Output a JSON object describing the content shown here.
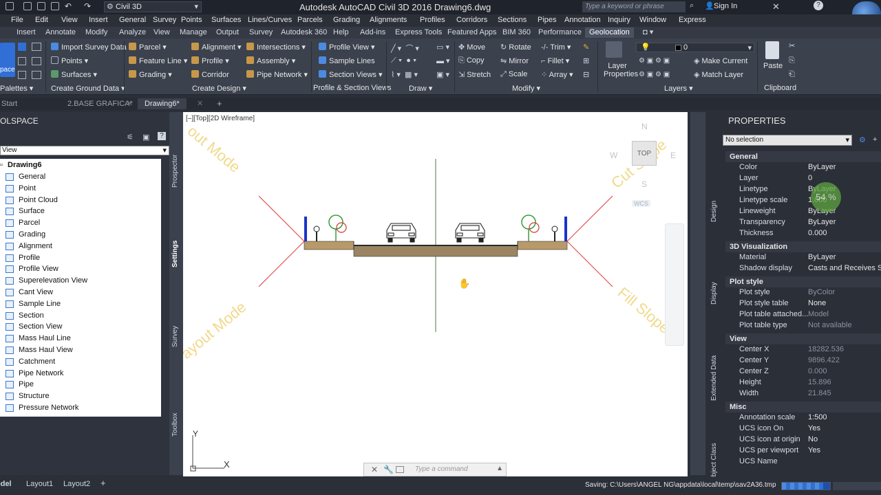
{
  "app": {
    "title": "Autodesk AutoCAD Civil 3D 2016    Drawing6.dwg",
    "workspace": "Civil 3D",
    "search_placeholder": "Type a keyword or phrase",
    "signin": "Sign In"
  },
  "menubar": [
    "File",
    "Edit",
    "View",
    "Insert",
    "General",
    "Survey",
    "Points",
    "Surfaces",
    "Lines/Curves",
    "Parcels",
    "Grading",
    "Alignments",
    "Profiles",
    "Corridors",
    "Sections",
    "Pipes",
    "Annotation",
    "Inquiry",
    "Window",
    "Express"
  ],
  "ribbon_tabs": [
    "Insert",
    "Annotate",
    "Modify",
    "Analyze",
    "View",
    "Manage",
    "Output",
    "Survey",
    "Autodesk 360",
    "Help",
    "Add-ins",
    "Express Tools",
    "Featured Apps",
    "BIM 360",
    "Performance",
    "Geolocation"
  ],
  "ribbon": {
    "palettes_label": "Palettes",
    "space_label": "pace",
    "ground": [
      "Import Survey Data",
      "Points",
      "Surfaces"
    ],
    "ground_title": "Create Ground Data",
    "design_col1": [
      "Parcel",
      "Feature Line",
      "Grading"
    ],
    "design_col2": [
      "Alignment",
      "Profile",
      "Corridor"
    ],
    "design_col3": [
      "Intersections",
      "Assembly",
      "Pipe Network"
    ],
    "design_title": "Create Design",
    "ps": [
      "Profile View",
      "Sample Lines",
      "Section Views"
    ],
    "ps_title": "Profile & Section Views",
    "draw_title": "Draw",
    "modify_col1": [
      "Move",
      "Copy",
      "Stretch"
    ],
    "modify_col2": [
      "Rotate",
      "Mirror",
      "Scale"
    ],
    "modify_col3": [
      "Trim",
      "Fillet",
      "Array"
    ],
    "modify_title": "Modify",
    "layer_props": [
      "Layer",
      "Properties"
    ],
    "layer_current": "0",
    "layer_btns": [
      "Make Current",
      "Match Layer"
    ],
    "layers_title": "Layers",
    "paste": "Paste",
    "clipboard_title": "Clipboard"
  },
  "doctabs": [
    "Start",
    "2.BASE GRAFICA*",
    "Drawing6*"
  ],
  "toolspace": {
    "title": "OLSPACE",
    "view": "View",
    "root": "Drawing6",
    "items": [
      "General",
      "Point",
      "Point Cloud",
      "Surface",
      "Parcel",
      "Grading",
      "Alignment",
      "Profile",
      "Profile View",
      "Superelevation View",
      "Cant View",
      "Sample Line",
      "Section",
      "Section View",
      "Mass Haul Line",
      "Mass Haul View",
      "Catchment",
      "Pipe Network",
      "Pipe",
      "Structure",
      "Pressure Network"
    ],
    "vtabs": [
      "Prospector",
      "Settings",
      "Survey",
      "Toolbox"
    ]
  },
  "canvas": {
    "viewport_label": "[–][Top][2D Wireframe]",
    "watermark_tl": "out Mode",
    "watermark_tr": "Cut Slope",
    "watermark_bl": "ayout Mode",
    "watermark_br": "Fill Slope",
    "viewcube": {
      "n": "N",
      "s": "S",
      "e": "E",
      "w": "W",
      "top": "TOP",
      "wcs": "WCS"
    },
    "ucs_x": "X",
    "ucs_y": "Y",
    "command_placeholder": "Type  a  command"
  },
  "properties": {
    "title": "PROPERTIES",
    "selection": "No selection",
    "side_tabs": [
      "Design",
      "Display",
      "Extended Data",
      "Object Class"
    ],
    "general_title": "General",
    "general": [
      {
        "label": "Color",
        "value": "ByLayer"
      },
      {
        "label": "Layer",
        "value": "0"
      },
      {
        "label": "Linetype",
        "value": "ByLayer"
      },
      {
        "label": "Linetype scale",
        "value": "1.000"
      },
      {
        "label": "Lineweight",
        "value": "ByLayer"
      },
      {
        "label": "Transparency",
        "value": "ByLayer"
      },
      {
        "label": "Thickness",
        "value": "0.000"
      }
    ],
    "viz_title": "3D Visualization",
    "viz": [
      {
        "label": "Material",
        "value": "ByLayer"
      },
      {
        "label": "Shadow display",
        "value": "Casts and Receives Sha"
      }
    ],
    "plot_title": "Plot style",
    "plot": [
      {
        "label": "Plot style",
        "value": "ByColor"
      },
      {
        "label": "Plot style table",
        "value": "None"
      },
      {
        "label": "Plot table attached...",
        "value": "Model"
      },
      {
        "label": "Plot table type",
        "value": "Not available"
      }
    ],
    "view_title": "View",
    "view": [
      {
        "label": "Center X",
        "value": "18282.536"
      },
      {
        "label": "Center Y",
        "value": "9896.422"
      },
      {
        "label": "Center Z",
        "value": "0.000"
      },
      {
        "label": "Height",
        "value": "15.896"
      },
      {
        "label": "Width",
        "value": "21.845"
      }
    ],
    "misc_title": "Misc",
    "misc": [
      {
        "label": "Annotation scale",
        "value": "1:500"
      },
      {
        "label": "UCS icon On",
        "value": "Yes"
      },
      {
        "label": "UCS icon at origin",
        "value": "No"
      },
      {
        "label": "UCS per viewport",
        "value": "Yes"
      },
      {
        "label": "UCS Name",
        "value": ""
      }
    ],
    "progress_text": "54 %",
    "progress_value": 0.54
  },
  "status": {
    "tabs": [
      "odel",
      "Layout1",
      "Layout2"
    ],
    "saving": "Saving: C:\\Users\\ANGEL NG\\appdata\\local\\temp\\sav2A36.tmp"
  },
  "colors": {
    "accent": "#2f6fd6",
    "red_line": "#e23a3a",
    "green_grid": "#4a7a4a"
  }
}
